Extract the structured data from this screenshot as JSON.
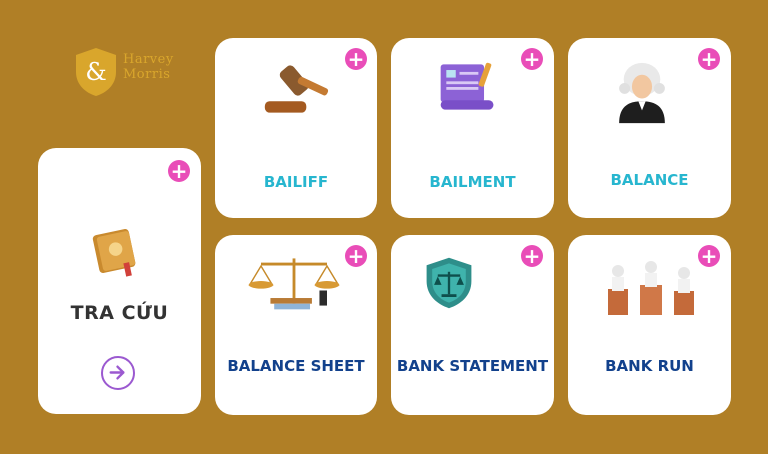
{
  "brand": {
    "logo_mark": "&",
    "name_line1": "Harvey",
    "name_line2": "Morris",
    "logo_color": "#D9A62C"
  },
  "lookup_card": {
    "title": "TRA CỨU",
    "icon": "book-icon",
    "arrow_icon": "arrow-right-circle-icon"
  },
  "plus_icon_symbol": "+",
  "terms": [
    {
      "label": "BAILIFF",
      "icon": "gavel-icon",
      "color": "#27B6CF"
    },
    {
      "label": "BAILMENT",
      "icon": "document-scroll-icon",
      "color": "#27B6CF"
    },
    {
      "label": "BALANCE",
      "icon": "judge-icon",
      "color": "#27B6CF"
    },
    {
      "label": "BALANCE SHEET",
      "icon": "scales-icon",
      "color": "#12418C"
    },
    {
      "label": "BANK STATEMENT",
      "icon": "shield-scales-icon",
      "color": "#12418C"
    },
    {
      "label": "BANK RUN",
      "icon": "courtroom-icon",
      "color": "#12418C"
    }
  ],
  "colors": {
    "background": "#B07F26",
    "card": "#FFFFFF",
    "plus": "#E94DB8",
    "arrow": "#9B59D0"
  }
}
